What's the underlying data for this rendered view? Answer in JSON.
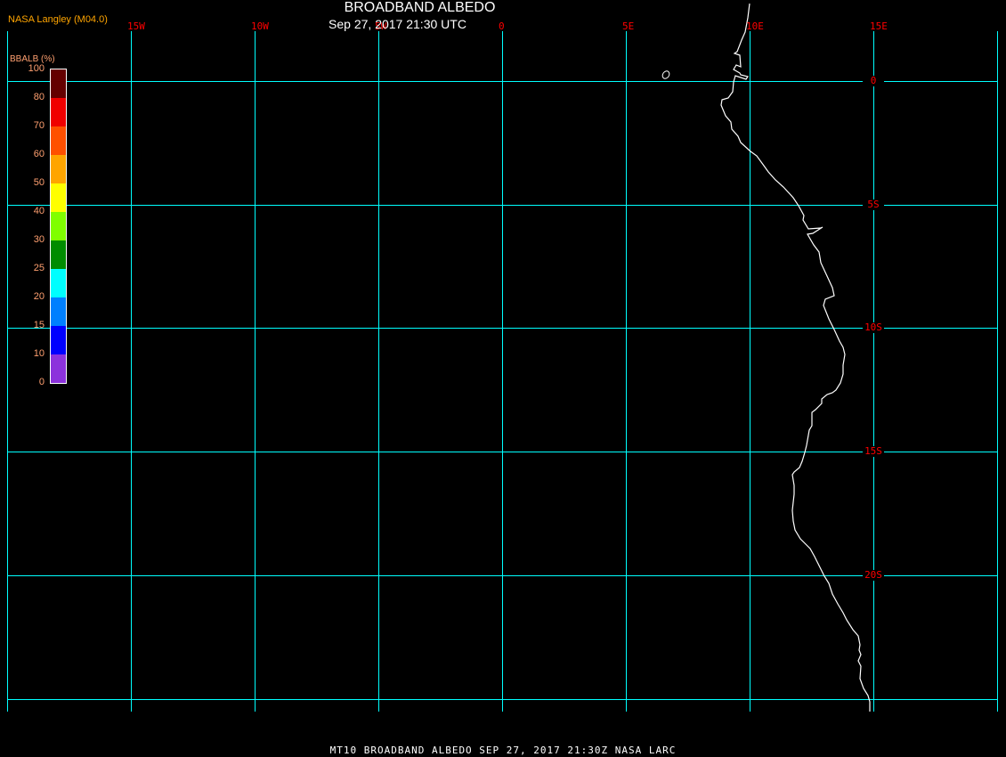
{
  "header": {
    "title": "BROADBAND ALBEDO",
    "subtitle": "Sep 27, 2017 21:30 UTC",
    "credit": "NASA Langley (M04.0)"
  },
  "colorbar": {
    "title": "BBALB (%)",
    "labels": [
      "100",
      "80",
      "70",
      "60",
      "50",
      "40",
      "30",
      "25",
      "20",
      "15",
      "10",
      "0"
    ],
    "colors": [
      "#640000",
      "#f00000",
      "#ff5000",
      "#ffa500",
      "#ffff00",
      "#80ff00",
      "#008c00",
      "#00ffff",
      "#0080ff",
      "#0000ff",
      "#8c32dc"
    ]
  },
  "grid": {
    "color": "#00ffff",
    "lon_labels": [
      "15W",
      "10W",
      "5W",
      "0",
      "5E",
      "10E",
      "15E"
    ],
    "lat_labels": [
      "0",
      "5S",
      "10S",
      "15S",
      "20S"
    ]
  },
  "coastline_color": "#ffffff",
  "footer": "MT10  BROADBAND ALBEDO   SEP 27, 2017 21:30Z   NASA LARC"
}
